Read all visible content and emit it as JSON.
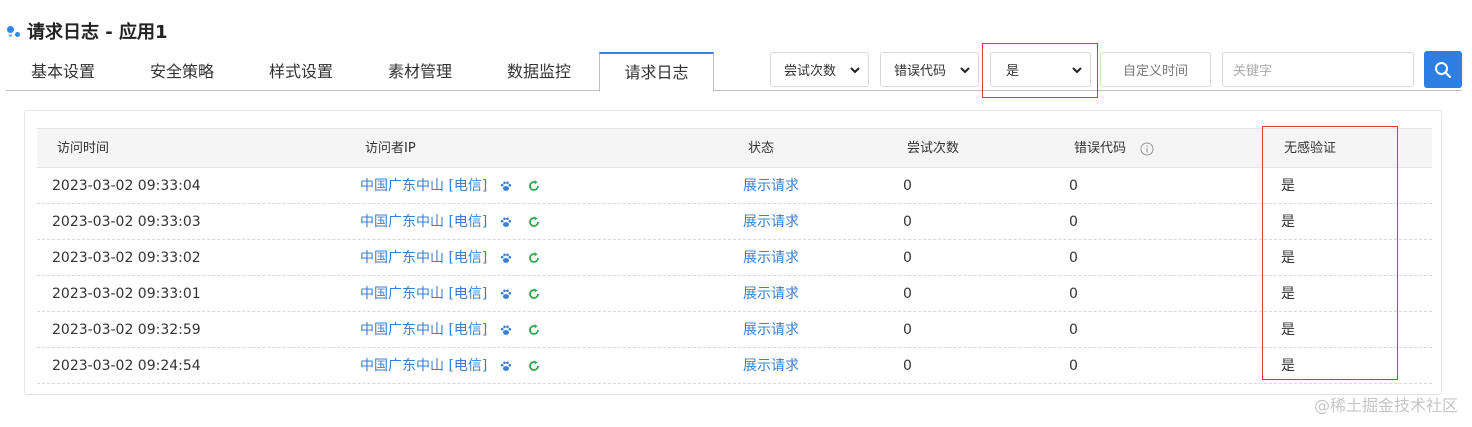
{
  "page": {
    "title": "请求日志 - 应用1"
  },
  "tabs": [
    {
      "label": "基本设置"
    },
    {
      "label": "安全策略"
    },
    {
      "label": "样式设置"
    },
    {
      "label": "素材管理"
    },
    {
      "label": "数据监控"
    },
    {
      "label": "请求日志",
      "active": true
    }
  ],
  "filters": {
    "attempts": {
      "value": "尝试次数"
    },
    "error_code": {
      "value": "错误代码"
    },
    "silent": {
      "value": "是"
    },
    "custom_time": {
      "label": "自定义时间"
    },
    "keyword": {
      "placeholder": "关键字"
    }
  },
  "table": {
    "headers": {
      "time": "访问时间",
      "ip": "访问者IP",
      "status": "状态",
      "attempts": "尝试次数",
      "error_code": "错误代码",
      "silent": "无感验证"
    },
    "rows": [
      {
        "time": "2023-03-02 09:33:04",
        "ip": "中国广东中山 [电信]",
        "status": "展示请求",
        "attempts": "0",
        "error_code": "0",
        "silent": "是"
      },
      {
        "time": "2023-03-02 09:33:03",
        "ip": "中国广东中山 [电信]",
        "status": "展示请求",
        "attempts": "0",
        "error_code": "0",
        "silent": "是"
      },
      {
        "time": "2023-03-02 09:33:02",
        "ip": "中国广东中山 [电信]",
        "status": "展示请求",
        "attempts": "0",
        "error_code": "0",
        "silent": "是"
      },
      {
        "time": "2023-03-02 09:33:01",
        "ip": "中国广东中山 [电信]",
        "status": "展示请求",
        "attempts": "0",
        "error_code": "0",
        "silent": "是"
      },
      {
        "time": "2023-03-02 09:32:59",
        "ip": "中国广东中山 [电信]",
        "status": "展示请求",
        "attempts": "0",
        "error_code": "0",
        "silent": "是"
      },
      {
        "time": "2023-03-02 09:24:54",
        "ip": "中国广东中山 [电信]",
        "status": "展示请求",
        "attempts": "0",
        "error_code": "0",
        "silent": "是"
      }
    ]
  },
  "icons": {
    "row_lookup": "paw-icon",
    "row_refresh": "refresh-icon",
    "search": "search-icon",
    "info": "info-icon"
  },
  "colors": {
    "accent": "#2d7fe3",
    "link": "#3b7fd0",
    "refresh": "#2eaa4a",
    "highlight": "#e53935"
  },
  "watermark": "@稀土掘金技术社区"
}
